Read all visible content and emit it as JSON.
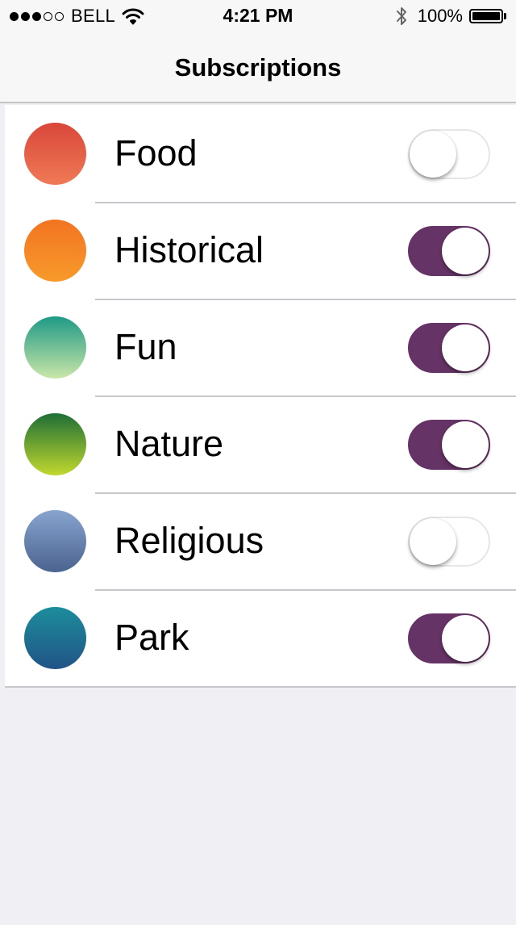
{
  "status_bar": {
    "signal": {
      "filled": 3,
      "empty": 2
    },
    "carrier": "BELL",
    "time": "4:21 PM",
    "battery_percent": "100%",
    "battery_level": 1.0,
    "icons": [
      "wifi-icon",
      "bluetooth-icon",
      "battery-icon"
    ]
  },
  "nav": {
    "title": "Subscriptions"
  },
  "accent_color": "#663366",
  "subscriptions": [
    {
      "label": "Food",
      "enabled": false,
      "gradient": [
        "#d9473a",
        "#ef7a56"
      ]
    },
    {
      "label": "Historical",
      "enabled": true,
      "gradient": [
        "#f27422",
        "#f89a2a"
      ]
    },
    {
      "label": "Fun",
      "enabled": true,
      "gradient": [
        "#1f9a86",
        "#c9e6a8"
      ]
    },
    {
      "label": "Nature",
      "enabled": true,
      "gradient": [
        "#1e6e36",
        "#c1d82e"
      ]
    },
    {
      "label": "Religious",
      "enabled": false,
      "gradient": [
        "#87a4cf",
        "#4b638f"
      ]
    },
    {
      "label": "Park",
      "enabled": true,
      "gradient": [
        "#1c8d9b",
        "#215487"
      ]
    }
  ]
}
